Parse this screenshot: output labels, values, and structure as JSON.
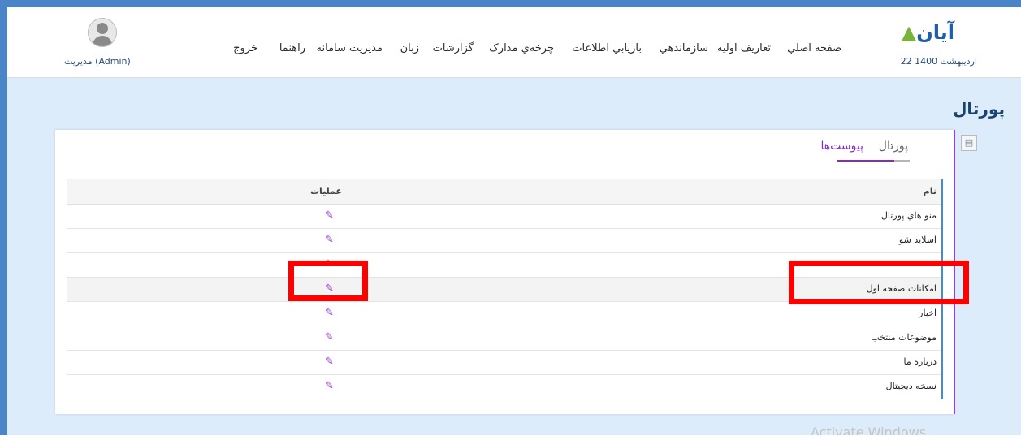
{
  "header": {
    "logo_text": "آیان",
    "date": "22 اردیبهشت 1400",
    "nav": [
      "صفحه اصلي",
      "تعاريف اوليه",
      "سازماندهي",
      "بازيابي اطلاعات",
      "چرخه‌ي مدارک",
      "گزارشات",
      "زبان",
      "مديريت سامانه",
      "راهنما",
      "خروج"
    ],
    "user_name": "مديريت (Admin)"
  },
  "page": {
    "title": "پورتال",
    "tabs": {
      "portal": "پورتال",
      "attachments": "پیوست‌ها"
    }
  },
  "table": {
    "columns": {
      "name": "نام",
      "operations": "عملیات"
    },
    "rows": [
      "منو هاي پورتال",
      "اسلايد شو",
      "",
      "امكانات صفحه اول",
      "اخبار",
      "موضوعات منتخب",
      "درباره ما",
      "نسخه ديجيتال"
    ]
  },
  "watermark": "Activate Windows",
  "colors": {
    "accent": "#9b3fd1",
    "highlight": "#ff0000",
    "page_bg": "#dcecfb",
    "frame": "#4a86c7"
  },
  "icons": [
    "user-avatar-icon",
    "document-icon",
    "edit-icon"
  ]
}
